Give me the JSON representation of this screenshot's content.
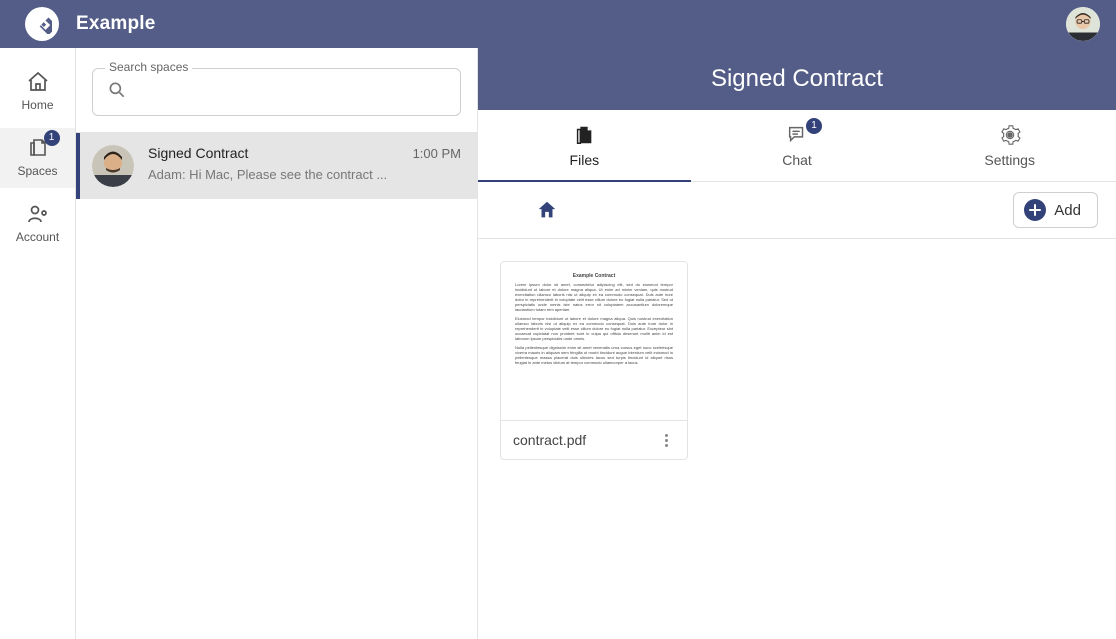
{
  "app": {
    "title": "Example"
  },
  "nav": {
    "home": "Home",
    "spaces": "Spaces",
    "spaces_badge": "1",
    "account": "Account"
  },
  "search": {
    "legend": "Search spaces",
    "placeholder": ""
  },
  "spaces_list": {
    "items": [
      {
        "title": "Signed Contract",
        "preview": "Adam: Hi Mac, Please see the contract ...",
        "time": "1:00 PM"
      }
    ]
  },
  "space_header": {
    "title": "Signed Contract"
  },
  "tabs": {
    "files": "Files",
    "chat": "Chat",
    "chat_badge": "1",
    "settings": "Settings"
  },
  "toolbar": {
    "add_label": "Add"
  },
  "files": {
    "items": [
      {
        "name": "contract.pdf",
        "doc_title": "Example Contract"
      }
    ]
  }
}
